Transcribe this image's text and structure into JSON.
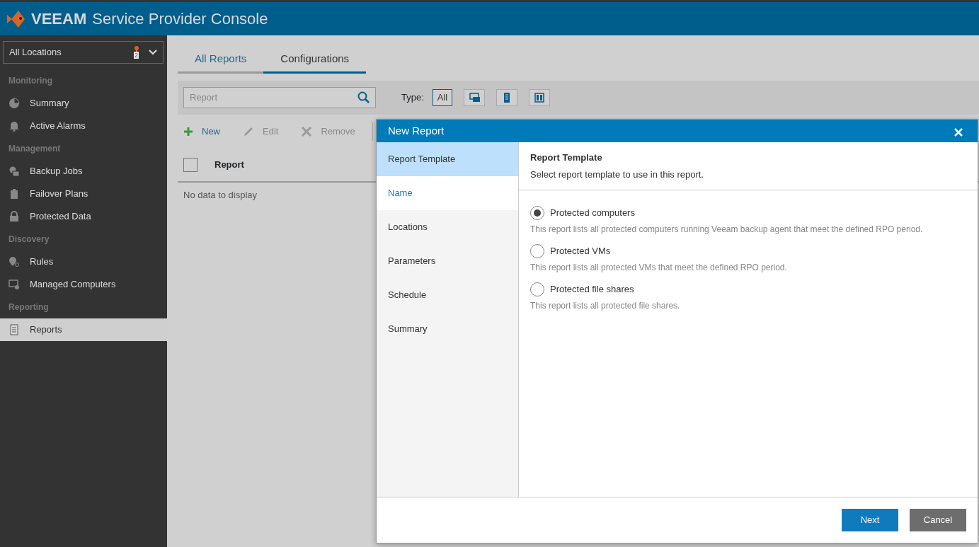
{
  "app": {
    "brand": "VEEAM",
    "title": "Service Provider Console"
  },
  "location_picker": {
    "value": "All Locations",
    "badge": "2"
  },
  "sidebar": [
    {
      "heading": "Monitoring",
      "items": [
        {
          "label": "Summary",
          "selected": false
        },
        {
          "label": "Active Alarms",
          "selected": false
        }
      ]
    },
    {
      "heading": "Management",
      "items": [
        {
          "label": "Backup Jobs",
          "selected": false
        },
        {
          "label": "Failover Plans",
          "selected": false
        },
        {
          "label": "Protected Data",
          "selected": false
        }
      ]
    },
    {
      "heading": "Discovery",
      "items": [
        {
          "label": "Rules",
          "selected": false
        },
        {
          "label": "Managed Computers",
          "selected": false
        }
      ]
    },
    {
      "heading": "Reporting",
      "items": [
        {
          "label": "Reports",
          "selected": true
        }
      ]
    }
  ],
  "tabs": [
    {
      "label": "All Reports",
      "selected": false
    },
    {
      "label": "Configurations",
      "selected": true
    }
  ],
  "search": {
    "placeholder": "Report"
  },
  "type_filter": {
    "label": "Type:",
    "options": [
      {
        "kind": "text",
        "label": "All",
        "selected": true
      },
      {
        "kind": "vm",
        "selected": false
      },
      {
        "kind": "server",
        "selected": false
      },
      {
        "kind": "cluster",
        "selected": false
      }
    ]
  },
  "toolbar": [
    {
      "kind": "add",
      "label": "New",
      "disabled": false
    },
    {
      "kind": "edit",
      "label": "Edit",
      "disabled": true
    },
    {
      "kind": "remove",
      "label": "Remove",
      "disabled": true
    }
  ],
  "table": {
    "columns": [
      "Report"
    ],
    "select_all_checked": false,
    "empty_text": "No data to display"
  },
  "dialog": {
    "title": "New Report",
    "steps": [
      {
        "label": "Report Template",
        "selected": true,
        "available": false
      },
      {
        "label": "Name",
        "selected": false,
        "available": true
      },
      {
        "label": "Locations",
        "selected": false,
        "available": false
      },
      {
        "label": "Parameters",
        "selected": false,
        "available": false
      },
      {
        "label": "Schedule",
        "selected": false,
        "available": false
      },
      {
        "label": "Summary",
        "selected": false,
        "available": false
      }
    ],
    "heading": "Report Template",
    "subheading": "Select report template to use in this report.",
    "options": [
      {
        "label": "Protected computers",
        "description": "This report lists all protected computers running Veeam backup agent that meet the defined RPO period.",
        "selected": true
      },
      {
        "label": "Protected VMs",
        "description": "This report lists all protected VMs that meet the defined RPO period.",
        "selected": false
      },
      {
        "label": "Protected file shares",
        "description": "This report lists all protected file shares.",
        "selected": false
      }
    ],
    "buttons": [
      {
        "kind": "primary",
        "label": "Next"
      },
      {
        "kind": "secondary",
        "label": "Cancel"
      }
    ]
  }
}
